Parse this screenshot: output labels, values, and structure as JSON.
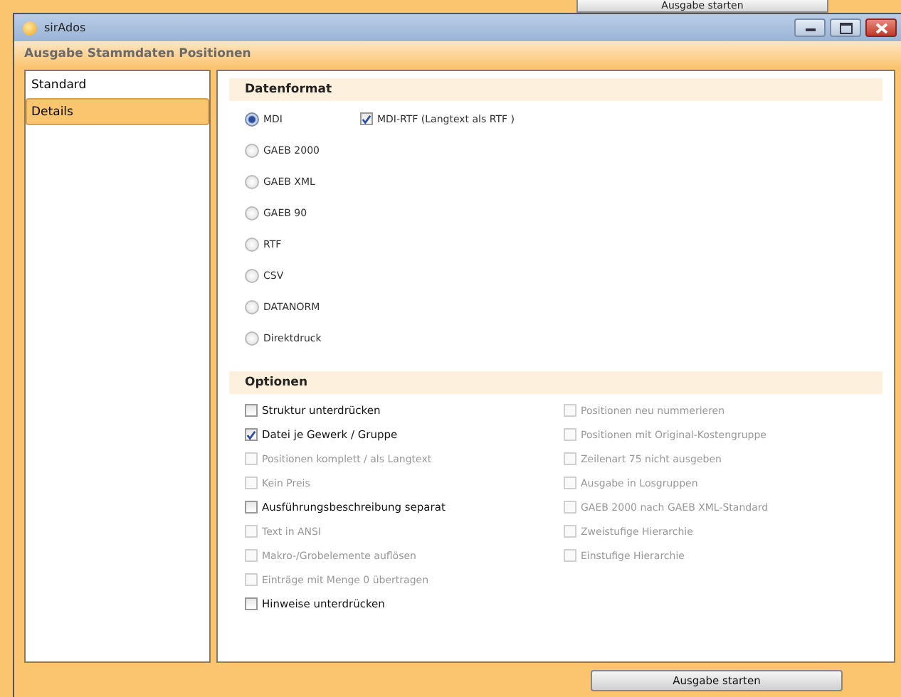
{
  "background_window": {
    "button": "Ausgabe starten"
  },
  "window": {
    "title": "sirAdos"
  },
  "header": "Ausgabe Stammdaten Positionen",
  "sidebar": {
    "items": [
      {
        "label": "Standard",
        "selected": false
      },
      {
        "label": "Details",
        "selected": true
      }
    ]
  },
  "datenformat": {
    "title": "Datenformat",
    "formats": [
      {
        "label": "MDI",
        "selected": true
      },
      {
        "label": "GAEB 2000",
        "selected": false
      },
      {
        "label": "GAEB XML",
        "selected": false
      },
      {
        "label": "GAEB 90",
        "selected": false
      },
      {
        "label": "RTF",
        "selected": false
      },
      {
        "label": "CSV",
        "selected": false
      },
      {
        "label": "DATANORM",
        "selected": false
      },
      {
        "label": "Direktdruck",
        "selected": false
      }
    ],
    "mdi_rtf": {
      "label": "MDI-RTF (Langtext als RTF )",
      "checked": true
    }
  },
  "optionen": {
    "title": "Optionen",
    "left": [
      {
        "label": "Struktur unterdrücken",
        "checked": false,
        "disabled": false
      },
      {
        "label": "Datei je Gewerk / Gruppe",
        "checked": true,
        "disabled": false
      },
      {
        "label": "Positionen komplett / als Langtext",
        "checked": false,
        "disabled": true
      },
      {
        "label": "Kein Preis",
        "checked": false,
        "disabled": true
      },
      {
        "label": "Ausführungsbeschreibung separat",
        "checked": false,
        "disabled": false
      },
      {
        "label": "Text in ANSI",
        "checked": false,
        "disabled": true
      },
      {
        "label": "Makro-/Grobelemente auflösen",
        "checked": false,
        "disabled": true
      },
      {
        "label": "Einträge mit Menge 0 übertragen",
        "checked": false,
        "disabled": true
      },
      {
        "label": "Hinweise unterdrücken",
        "checked": false,
        "disabled": false
      }
    ],
    "right": [
      {
        "label": "Positionen neu nummerieren",
        "checked": false,
        "disabled": true
      },
      {
        "label": "Positionen mit Original-Kostengruppe",
        "checked": false,
        "disabled": true
      },
      {
        "label": "Zeilenart 75 nicht ausgeben",
        "checked": false,
        "disabled": true
      },
      {
        "label": "Ausgabe in Losgruppen",
        "checked": false,
        "disabled": true
      },
      {
        "label": "GAEB 2000 nach GAEB XML-Standard",
        "checked": false,
        "disabled": true
      },
      {
        "label": "Zweistufige Hierarchie",
        "checked": false,
        "disabled": true
      },
      {
        "label": "Einstufige Hierarchie",
        "checked": false,
        "disabled": true
      }
    ]
  },
  "footer": {
    "button": "Ausgabe starten"
  }
}
